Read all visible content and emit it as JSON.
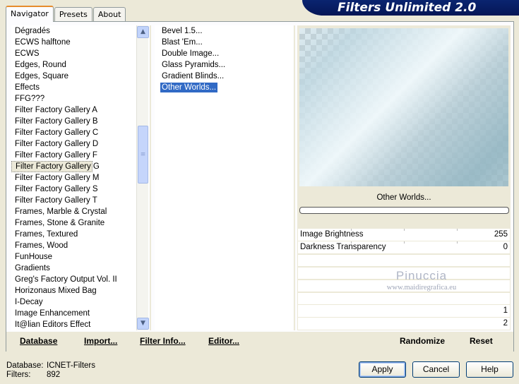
{
  "tabs": [
    {
      "label": "Navigator",
      "active": true
    },
    {
      "label": "Presets",
      "active": false
    },
    {
      "label": "About",
      "active": false
    }
  ],
  "app_title": "Filters Unlimited 2.0",
  "categories": [
    "Dégradés",
    "ECWS halftone",
    "ECWS",
    "Edges, Round",
    "Edges, Square",
    "Effects",
    "FFG???",
    "Filter Factory Gallery A",
    "Filter Factory Gallery B",
    "Filter Factory Gallery C",
    "Filter Factory Gallery D",
    "Filter Factory Gallery F",
    "Filter Factory Gallery G",
    "Filter Factory Gallery M",
    "Filter Factory Gallery S",
    "Filter Factory Gallery T",
    "Frames, Marble & Crystal",
    "Frames, Stone & Granite",
    "Frames, Textured",
    "Frames, Wood",
    "FunHouse",
    "Gradients",
    "Greg's Factory Output Vol. II",
    "Horizonaus Mixed Bag",
    "I-Decay",
    "Image Enhancement",
    "It@lian Editors Effect"
  ],
  "selected_category": "Filter Factory Gallery G",
  "filters": [
    "Bevel 1.5...",
    "Blast 'Em...",
    "Double Image...",
    "Glass Pyramids...",
    "Gradient Blinds...",
    "Other Worlds..."
  ],
  "selected_filter": "Other Worlds...",
  "preview": {
    "filter_name": "Other Worlds..."
  },
  "params": [
    {
      "label": "Image Brightness",
      "value": "255"
    },
    {
      "label": "Darkness Transparency",
      "value": "0"
    }
  ],
  "extra_values": [
    "1",
    "2"
  ],
  "watermark": {
    "line1": "Pinuccia",
    "line2": "www.maidiregrafica.eu"
  },
  "bottom_links": {
    "database": "Database",
    "import": "Import...",
    "filter_info": "Filter Info...",
    "editor": "Editor...",
    "randomize": "Randomize",
    "reset": "Reset"
  },
  "info": {
    "database_label": "Database:",
    "database_value": "ICNET-Filters",
    "filters_label": "Filters:",
    "filters_value": "892"
  },
  "buttons": {
    "apply": "Apply",
    "cancel": "Cancel",
    "help": "Help"
  },
  "colors": {
    "selection": "#316ac5",
    "banner": "#0a2470",
    "tab_accent": "#e68b2c"
  }
}
